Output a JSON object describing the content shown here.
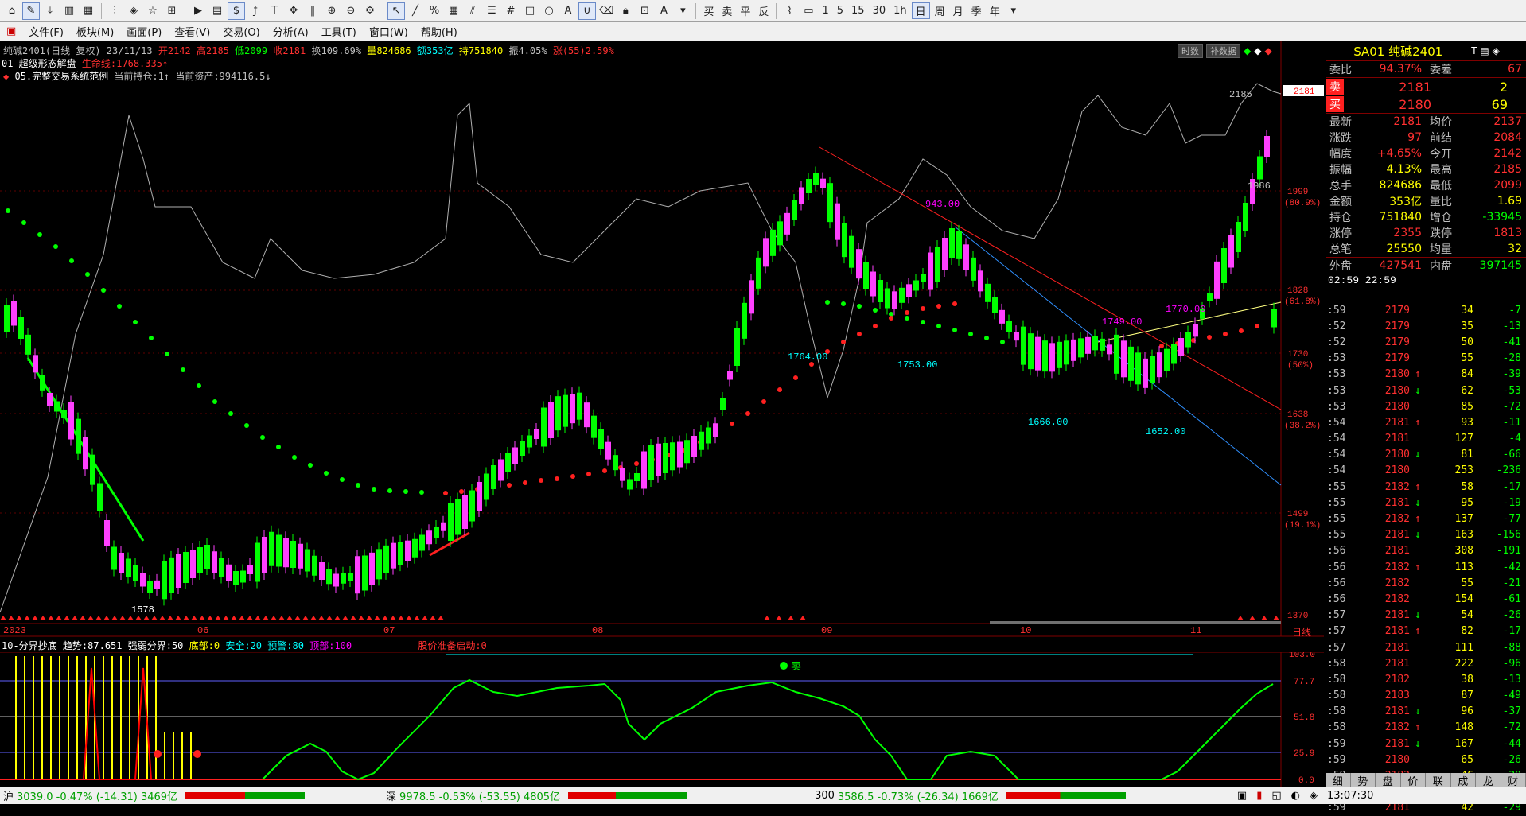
{
  "toolbar": {
    "icons": [
      "home-icon",
      "draw-icon",
      "download-icon",
      "layout-icon",
      "chart-icon",
      "target-icon",
      "star-icon",
      "f10-icon",
      "dollar-icon",
      "formula-icon",
      "text-icon",
      "move-icon",
      "ruler-icon",
      "zoom-in-icon",
      "zoom-out-icon",
      "settings-icon",
      "cursor-icon",
      "line-icon",
      "percent-icon",
      "grid-icon",
      "channel-icon",
      "fib-icon",
      "hash-icon",
      "rect-icon",
      "circle-icon",
      "letter-a-icon",
      "magnet-icon",
      "eraser-icon",
      "lock-icon",
      "lock2-icon",
      "color-icon",
      "menu-icon"
    ],
    "trade_buttons": [
      "买",
      "卖",
      "平",
      "反"
    ],
    "periods": [
      "1",
      "5",
      "15",
      "30",
      "1h",
      "日",
      "周",
      "月",
      "季",
      "年"
    ]
  },
  "menu": [
    "文件(F)",
    "板块(M)",
    "画面(P)",
    "查看(V)",
    "交易(O)",
    "分析(A)",
    "工具(T)",
    "窗口(W)",
    "帮助(H)"
  ],
  "header": {
    "line1": {
      "name": "纯碱2401(日线 复权) 23/11/13",
      "open_label": "开",
      "open": "2142",
      "high_label": "高",
      "high": "2185",
      "low_label": "低",
      "low": "2099",
      "close_label": "收",
      "close": "2181",
      "turnover_label": "换",
      "turnover": "109.69%",
      "vol_label": "量",
      "vol": "824686",
      "amount_label": "额",
      "amount": "353亿",
      "oi_label": "持",
      "oi": "751840",
      "amp_label": "振",
      "amp": "4.05%",
      "chg_label": "涨(55)",
      "chg": "2.59%"
    },
    "line2": {
      "indicator": "01-超级形态解盘",
      "extra": "生命线:1768.335↑"
    },
    "line3": {
      "indicator": "05.完整交易系统范例",
      "pos": "当前持仓:1↑",
      "assets": "当前资产:994116.5↓"
    },
    "buttons": [
      "时数",
      "补数据"
    ]
  },
  "price_axis": [
    {
      "price": "1999",
      "pct": "(80.9%)"
    },
    {
      "price": "1828",
      "pct": "(61.8%)"
    },
    {
      "price": "1730",
      "pct": "(50%)"
    },
    {
      "price": "1638",
      "pct": "(38.2%)"
    },
    {
      "price": "1499",
      "pct": "(19.1%)"
    },
    {
      "price": "1370",
      "pct": ""
    }
  ],
  "price_tag": "2181",
  "chart_annotations": [
    "2185",
    "1986",
    "1764.00",
    "1753.00",
    "1666.00",
    "1652.00",
    "943.00",
    "1578",
    "1770.00",
    "1749.00"
  ],
  "date_axis": [
    "2023",
    "06",
    "07",
    "08",
    "09",
    "10",
    "11",
    "日线"
  ],
  "sub_indicator": {
    "title": "10-分界抄底",
    "trend": "趋势:87.651",
    "strong": "强弱分界:50",
    "bottom": "底部:0",
    "safe": "安全:20",
    "warn": "预警:80",
    "top": "顶部:100",
    "extra": "股价准备启动:0",
    "sell_label": "卖",
    "axis": [
      "103.0",
      "77.7",
      "51.8",
      "25.9",
      "0.0"
    ]
  },
  "quote": {
    "title": "SA01 纯碱2401",
    "weibi_label": "委比",
    "weibi": "94.37%",
    "weicha_label": "委差",
    "weicha": "67",
    "sell_label": "卖",
    "sell_price": "2181",
    "sell_vol": "2",
    "buy_label": "买",
    "buy_price": "2180",
    "buy_vol": "69",
    "rows": [
      {
        "l1": "最新",
        "v1": "2181",
        "l2": "均价",
        "v2": "2137"
      },
      {
        "l1": "涨跌",
        "v1": "97",
        "l2": "前结",
        "v2": "2084"
      },
      {
        "l1": "幅度",
        "v1": "+4.65%",
        "l2": "今开",
        "v2": "2142"
      },
      {
        "l1": "振幅",
        "v1": "4.13%",
        "l2": "最高",
        "v2": "2185"
      },
      {
        "l1": "总手",
        "v1": "824686",
        "l2": "最低",
        "v2": "2099"
      },
      {
        "l1": "金额",
        "v1": "353亿",
        "l2": "量比",
        "v2": "1.69"
      },
      {
        "l1": "持仓",
        "v1": "751840",
        "l2": "增仓",
        "v2": "-33945"
      },
      {
        "l1": "涨停",
        "v1": "2355",
        "l2": "跌停",
        "v2": "1813"
      },
      {
        "l1": "总笔",
        "v1": "25550",
        "l2": "均量",
        "v2": "32"
      }
    ],
    "outer_label": "外盘",
    "outer": "427541",
    "inner_label": "内盘",
    "inner": "397145",
    "tick_header": "02:59 22:59"
  },
  "ticks": [
    {
      "t": ":59",
      "p": "2179",
      "a": "",
      "v": "34",
      "c": "-7"
    },
    {
      "t": ":52",
      "p": "2179",
      "a": "",
      "v": "35",
      "c": "-13"
    },
    {
      "t": ":52",
      "p": "2179",
      "a": "",
      "v": "50",
      "c": "-41"
    },
    {
      "t": ":53",
      "p": "2179",
      "a": "",
      "v": "55",
      "c": "-28"
    },
    {
      "t": ":53",
      "p": "2180",
      "a": "↑",
      "v": "84",
      "c": "-39"
    },
    {
      "t": ":53",
      "p": "2180",
      "a": "↓",
      "v": "62",
      "c": "-53"
    },
    {
      "t": ":53",
      "p": "2180",
      "a": "",
      "v": "85",
      "c": "-72"
    },
    {
      "t": ":54",
      "p": "2181",
      "a": "↑",
      "v": "93",
      "c": "-11"
    },
    {
      "t": ":54",
      "p": "2181",
      "a": "",
      "v": "127",
      "c": "-4"
    },
    {
      "t": ":54",
      "p": "2180",
      "a": "↓",
      "v": "81",
      "c": "-66"
    },
    {
      "t": ":54",
      "p": "2180",
      "a": "",
      "v": "253",
      "c": "-236"
    },
    {
      "t": ":55",
      "p": "2182",
      "a": "↑",
      "v": "58",
      "c": "-17"
    },
    {
      "t": ":55",
      "p": "2181",
      "a": "↓",
      "v": "95",
      "c": "-19"
    },
    {
      "t": ":55",
      "p": "2182",
      "a": "↑",
      "v": "137",
      "c": "-77"
    },
    {
      "t": ":55",
      "p": "2181",
      "a": "↓",
      "v": "163",
      "c": "-156"
    },
    {
      "t": ":56",
      "p": "2181",
      "a": "",
      "v": "308",
      "c": "-191"
    },
    {
      "t": ":56",
      "p": "2182",
      "a": "↑",
      "v": "113",
      "c": "-42"
    },
    {
      "t": ":56",
      "p": "2182",
      "a": "",
      "v": "55",
      "c": "-21"
    },
    {
      "t": ":56",
      "p": "2182",
      "a": "",
      "v": "154",
      "c": "-61"
    },
    {
      "t": ":57",
      "p": "2181",
      "a": "↓",
      "v": "54",
      "c": "-26"
    },
    {
      "t": ":57",
      "p": "2181",
      "a": "↑",
      "v": "82",
      "c": "-17"
    },
    {
      "t": ":57",
      "p": "2181",
      "a": "",
      "v": "111",
      "c": "-88"
    },
    {
      "t": ":58",
      "p": "2181",
      "a": "",
      "v": "222",
      "c": "-96"
    },
    {
      "t": ":58",
      "p": "2182",
      "a": "",
      "v": "38",
      "c": "-13"
    },
    {
      "t": ":58",
      "p": "2183",
      "a": "",
      "v": "87",
      "c": "-49"
    },
    {
      "t": ":58",
      "p": "2181",
      "a": "↓",
      "v": "96",
      "c": "-37"
    },
    {
      "t": ":58",
      "p": "2182",
      "a": "↑",
      "v": "148",
      "c": "-72"
    },
    {
      "t": ":59",
      "p": "2181",
      "a": "↓",
      "v": "167",
      "c": "-44"
    },
    {
      "t": ":59",
      "p": "2180",
      "a": "",
      "v": "65",
      "c": "-26"
    },
    {
      "t": ":59",
      "p": "2182",
      "a": "↑",
      "v": "46",
      "c": "-29"
    },
    {
      "t": ":59",
      "p": "2182",
      "a": "",
      "v": "75",
      "c": "-20"
    },
    {
      "t": ":59",
      "p": "2181",
      "a": "",
      "v": "42",
      "c": "-29"
    }
  ],
  "detail_tabs": [
    "细",
    "势",
    "盘",
    "价",
    "联",
    "成",
    "龙",
    "财"
  ],
  "status": {
    "sh_label": "沪",
    "sh": "3039.0 -0.47% (-14.31) 3469亿",
    "sz_label": "深",
    "sz": "9978.5 -0.53% (-53.55) 4805亿",
    "c300_label": "300",
    "c300": "3586.5 -0.73% (-26.34) 1669亿",
    "clock": "13:07:30"
  },
  "colors": {
    "up": "#ff00ff",
    "down": "#00ff00",
    "red": "#ff2020",
    "yellow": "#ffff00",
    "cyan": "#00ffff"
  }
}
